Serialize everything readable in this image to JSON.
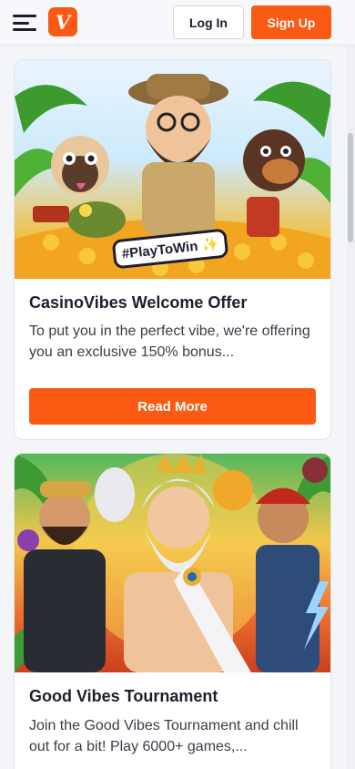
{
  "header": {
    "menu_icon": "hamburger-menu-icon",
    "logo_letter": "V",
    "login_label": "Log In",
    "signup_label": "Sign Up"
  },
  "colors": {
    "brand": "#fa5a14",
    "page_bg": "#f4f5f9",
    "card_bg": "#ffffff",
    "text": "#1e1e2e"
  },
  "promotions": [
    {
      "image_text": "#PlayToWin ✨",
      "title": "CasinoVibes Welcome Offer",
      "description": "To put you in the perfect vibe, we're offering you an exclusive 150% bonus...",
      "cta_label": "Read More"
    },
    {
      "title": "Good Vibes Tournament",
      "description": "Join the Good Vibes Tournament and chill out for a bit! Play 6000+ games,..."
    }
  ]
}
